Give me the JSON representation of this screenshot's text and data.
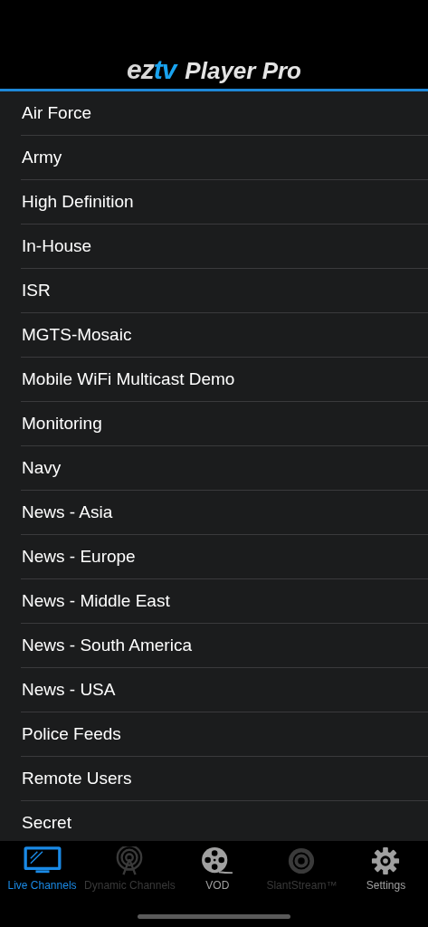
{
  "header": {
    "logo": {
      "brand": "ez",
      "brand_accent": "tv",
      "product": "Player Pro"
    }
  },
  "channel_groups": [
    {
      "name": "Air Force"
    },
    {
      "name": "Army"
    },
    {
      "name": "High Definition"
    },
    {
      "name": "In-House"
    },
    {
      "name": "ISR"
    },
    {
      "name": "MGTS-Mosaic"
    },
    {
      "name": "Mobile WiFi Multicast Demo"
    },
    {
      "name": "Monitoring"
    },
    {
      "name": "Navy"
    },
    {
      "name": "News - Asia"
    },
    {
      "name": "News - Europe"
    },
    {
      "name": "News - Middle East"
    },
    {
      "name": "News - South America"
    },
    {
      "name": "News - USA"
    },
    {
      "name": "Police Feeds"
    },
    {
      "name": "Remote Users"
    },
    {
      "name": "Secret"
    }
  ],
  "tab_bar": [
    {
      "label": "Live Channels",
      "selected": true,
      "disabled": false
    },
    {
      "label": "Dynamic Channels",
      "selected": false,
      "disabled": true
    },
    {
      "label": "VOD",
      "selected": false,
      "disabled": false
    },
    {
      "label": "SlantStream™",
      "selected": false,
      "disabled": true
    },
    {
      "label": "Settings",
      "selected": false,
      "disabled": false
    }
  ]
}
